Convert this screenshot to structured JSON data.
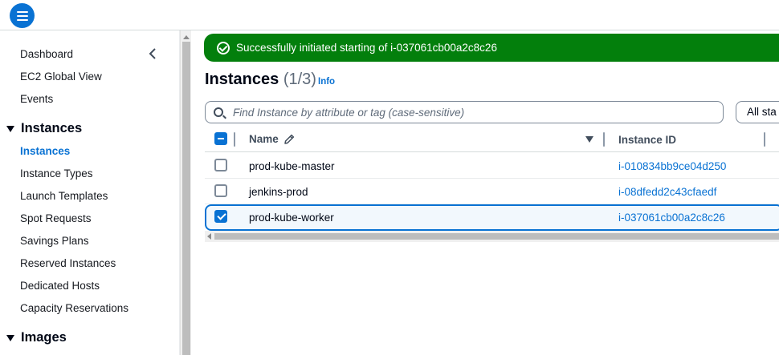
{
  "sidebar": {
    "items": [
      {
        "label": "Dashboard"
      },
      {
        "label": "EC2 Global View"
      },
      {
        "label": "Events"
      }
    ],
    "section_instances": "Instances",
    "instances_items": [
      {
        "label": "Instances",
        "active": true
      },
      {
        "label": "Instance Types"
      },
      {
        "label": "Launch Templates"
      },
      {
        "label": "Spot Requests"
      },
      {
        "label": "Savings Plans"
      },
      {
        "label": "Reserved Instances"
      },
      {
        "label": "Dedicated Hosts"
      },
      {
        "label": "Capacity Reservations"
      }
    ],
    "section_images": "Images"
  },
  "flash": {
    "message": "Successfully initiated starting of i-037061cb00a2c8c26",
    "type": "success",
    "color": "#037f0c"
  },
  "header": {
    "title": "Instances",
    "count": "(1/3)",
    "info_label": "Info"
  },
  "search": {
    "placeholder": "Find Instance by attribute or tag (case-sensitive)",
    "value": ""
  },
  "state_filter": {
    "label": "All sta"
  },
  "table": {
    "columns": [
      "Name",
      "Instance ID"
    ],
    "rows": [
      {
        "name": "prod-kube-master",
        "instance_id": "i-010834bb9ce04d250",
        "selected": false
      },
      {
        "name": "jenkins-prod",
        "instance_id": "i-08dfedd2c43cfaedf",
        "selected": false
      },
      {
        "name": "prod-kube-worker",
        "instance_id": "i-037061cb00a2c8c26",
        "selected": true
      }
    ]
  },
  "colors": {
    "accent": "#0972d3",
    "success": "#037f0c"
  }
}
